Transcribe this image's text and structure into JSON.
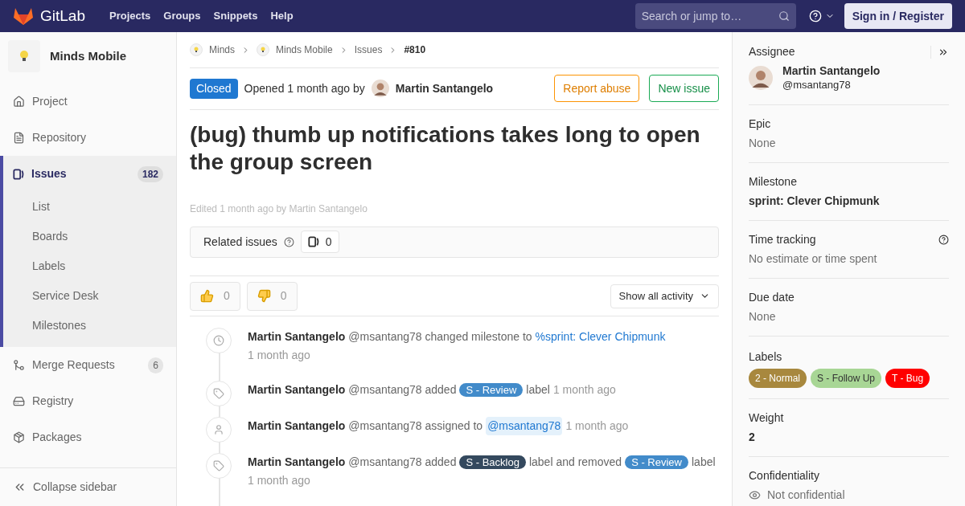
{
  "header": {
    "brand": "GitLab",
    "nav": [
      "Projects",
      "Groups",
      "Snippets",
      "Help"
    ],
    "search": {
      "placeholder": "Search or jump to…"
    },
    "sign_in": "Sign in / Register"
  },
  "sidebar": {
    "project": "Minds Mobile",
    "items": [
      {
        "label": "Project",
        "selected": false
      },
      {
        "label": "Repository",
        "selected": false
      },
      {
        "label": "Issues",
        "selected": true,
        "count": "182",
        "children": [
          {
            "label": "List"
          },
          {
            "label": "Boards"
          },
          {
            "label": "Labels"
          },
          {
            "label": "Service Desk"
          },
          {
            "label": "Milestones"
          }
        ]
      },
      {
        "label": "Merge Requests",
        "selected": false,
        "count": "6"
      },
      {
        "label": "Registry",
        "selected": false
      },
      {
        "label": "Packages",
        "selected": false
      }
    ],
    "collapse": "Collapse sidebar"
  },
  "breadcrumbs": [
    "Minds",
    "Minds Mobile",
    "Issues",
    "#810"
  ],
  "issue": {
    "status": "Closed",
    "opened": "Opened 1 month ago by",
    "author": "Martin Santangelo",
    "report": "Report abuse",
    "new_issue": "New issue",
    "title": "(bug) thumb up notifications takes long to open the group screen",
    "edited": "Edited 1 month ago by Martin Santangelo"
  },
  "related": {
    "label": "Related issues",
    "count": "0"
  },
  "reactions": [
    {
      "kind": "up",
      "count": "0"
    },
    {
      "kind": "down",
      "count": "0"
    }
  ],
  "activity_filter": "Show all activity",
  "events": [
    {
      "kind": "milestone",
      "author": "Martin Santangelo",
      "parts": [
        {
          "kind": "text",
          "text": "@msantang78 changed milestone to"
        },
        {
          "kind": "link",
          "text": "%sprint: Clever Chipmunk"
        },
        {
          "kind": "break"
        },
        {
          "kind": "time",
          "text": "1 month ago"
        }
      ]
    },
    {
      "kind": "label",
      "author": "Martin Santangelo",
      "parts": [
        {
          "kind": "text",
          "text": "@msantang78 added"
        },
        {
          "kind": "label",
          "text": "S - Review",
          "color": "#428bca"
        },
        {
          "kind": "text",
          "text": "label"
        },
        {
          "kind": "time",
          "text": "1 month ago"
        }
      ]
    },
    {
      "kind": "assign",
      "author": "Martin Santangelo",
      "parts": [
        {
          "kind": "text",
          "text": "@msantang78 assigned to"
        },
        {
          "kind": "mention",
          "text": "@msantang78"
        },
        {
          "kind": "time",
          "text": "1 month ago"
        }
      ]
    },
    {
      "kind": "label",
      "author": "Martin Santangelo",
      "parts": [
        {
          "kind": "text",
          "text": "@msantang78 added"
        },
        {
          "kind": "label",
          "text": "S - Backlog",
          "color": "#34495e"
        },
        {
          "kind": "text",
          "text": "label and removed"
        },
        {
          "kind": "label",
          "text": "S - Review",
          "color": "#428bca"
        },
        {
          "kind": "text",
          "text": "label"
        },
        {
          "kind": "time",
          "text": "1 month ago"
        }
      ]
    }
  ],
  "details": [
    {
      "kind": "assignee",
      "title": "Assignee",
      "name": "Martin Santangelo",
      "handle": "@msantang78"
    },
    {
      "kind": "plain",
      "title": "Epic",
      "value": "None"
    },
    {
      "kind": "bold",
      "title": "Milestone",
      "value": "sprint: Clever Chipmunk"
    },
    {
      "kind": "help",
      "title": "Time tracking",
      "value": "No estimate or time spent"
    },
    {
      "kind": "plain",
      "title": "Due date",
      "value": "None"
    },
    {
      "kind": "labels",
      "title": "Labels",
      "labels": [
        {
          "text": "2 - Normal",
          "color": "#a8883e"
        },
        {
          "text": "S - Follow Up",
          "color": "#a8d695"
        },
        {
          "text": "T - Bug",
          "color": "#ff0000"
        }
      ]
    },
    {
      "kind": "bold",
      "title": "Weight",
      "value": "2"
    },
    {
      "kind": "eye",
      "title": "Confidentiality",
      "value": "Not confidential"
    }
  ]
}
